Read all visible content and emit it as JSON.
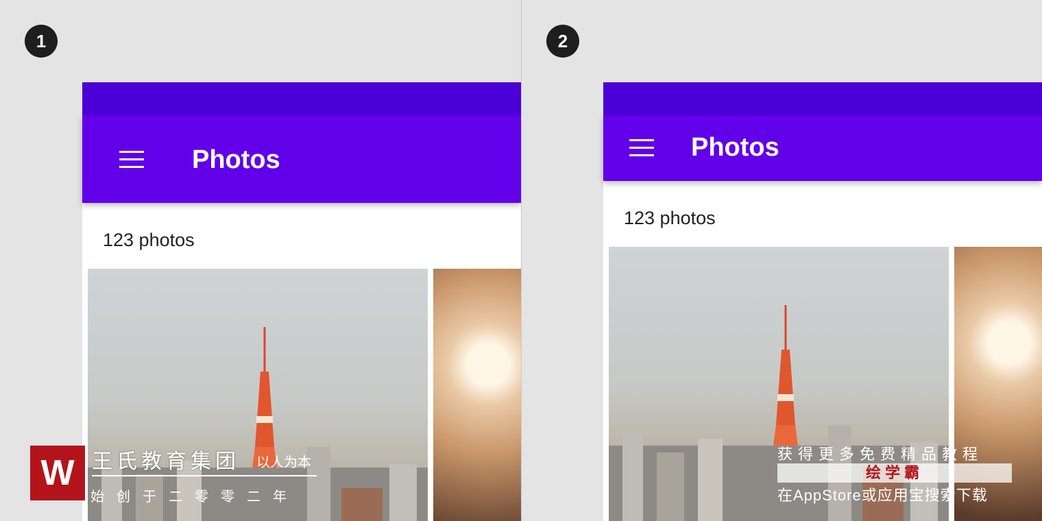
{
  "panels": [
    {
      "step": "1",
      "app_title": "Photos",
      "photo_count": "123 photos"
    },
    {
      "step": "2",
      "app_title": "Photos",
      "photo_count": "123 photos"
    }
  ],
  "icons": {
    "menu": "menu-icon"
  },
  "colors": {
    "status_bar": "#4a00d6",
    "app_bar": "#6200ea",
    "badge": "#1e1e1e",
    "watermark_red": "#b3141c"
  },
  "watermark_left": {
    "logo": "W",
    "name": "王氏教育集团",
    "motto": "以人为本",
    "sub": "始创于二零零二年"
  },
  "watermark_right": {
    "line1": "获得更多免费精品教程",
    "line2": "绘学霸",
    "line3": "在AppStore或应用宝搜索下载"
  }
}
